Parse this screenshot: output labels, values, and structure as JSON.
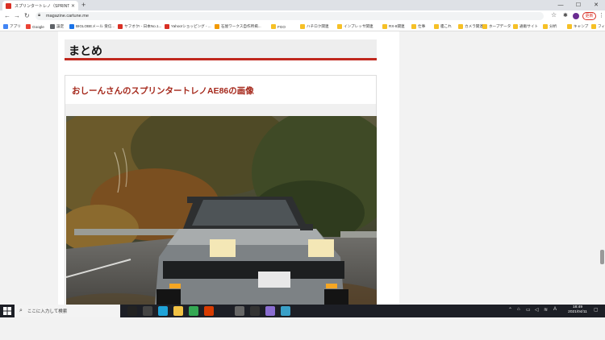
{
  "browser": {
    "tab_title": "スプリンタートレノ（SPRINTER TRUENO",
    "url": "magazine.cartune.me",
    "update_label": "更新",
    "bookmarks": [
      {
        "label": "アプリ",
        "color": "#4285f4"
      },
      {
        "label": "Google",
        "color": "#ea4335"
      },
      {
        "label": "設定",
        "color": "#5f6368"
      },
      {
        "label": "BIGLOBEメール 受信...",
        "color": "#1a73e8"
      },
      {
        "label": "ヤフオク! - 日本No.1...",
        "color": "#d93025"
      },
      {
        "label": "Yahoo!ショッピング - ...",
        "color": "#d93025"
      },
      {
        "label": "石屋ワークス自作所掲...",
        "color": "#f29900"
      },
      {
        "label": "FGO",
        "color": "#f6c026"
      },
      {
        "label": "ハチロク関連",
        "color": "#f6c026"
      },
      {
        "label": "インプレッサ関連",
        "color": "#f6c026"
      },
      {
        "label": "RX-8関連",
        "color": "#f6c026"
      },
      {
        "label": "仕事",
        "color": "#f6c026"
      },
      {
        "label": "艦これ",
        "color": "#f6c026"
      },
      {
        "label": "カメラ関連",
        "color": "#f6c026"
      },
      {
        "label": "ホープデータ",
        "color": "#f6c026"
      },
      {
        "label": "通販サイト",
        "color": "#f6c026"
      },
      {
        "label": "分析",
        "color": "#f6c026"
      },
      {
        "label": "キャンプ",
        "color": "#f6c026"
      },
      {
        "label": "フィットネス",
        "color": "#f6c026"
      }
    ]
  },
  "article": {
    "heading": "まとめ",
    "card_title": "おしーんさんのスプリンタートレノAE86の画像",
    "accent_color": "#c0281e"
  },
  "taskbar": {
    "search_placeholder": "ここに入力して検索",
    "time": "18:49",
    "date": "2021/04/11",
    "apps": [
      {
        "icon": "cortana-icon",
        "color": "#222222"
      },
      {
        "icon": "task-view-icon",
        "color": "#444444"
      },
      {
        "icon": "edge-icon",
        "color": "#1fa3d8"
      },
      {
        "icon": "file-explorer-icon",
        "color": "#f2c244"
      },
      {
        "icon": "chrome-icon",
        "color": "#34a853"
      },
      {
        "icon": "office-icon",
        "color": "#d83b01"
      },
      {
        "icon": "app-icon",
        "color": "#666666"
      },
      {
        "icon": "media-icon",
        "color": "#333333"
      },
      {
        "icon": "photos-icon",
        "color": "#8a6dd1"
      },
      {
        "icon": "app-icon-2",
        "color": "#3aa0c8"
      }
    ]
  }
}
